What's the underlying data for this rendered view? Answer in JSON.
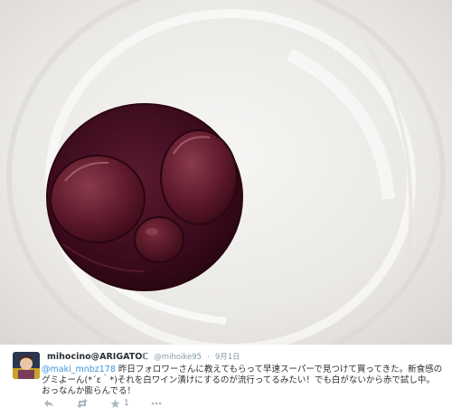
{
  "tweet": {
    "display_name": "mihocino@ARIGATOℂ",
    "handle": "@mihoike95",
    "separator": "·",
    "time": "9月1日",
    "mention": "@maki_mnbz178",
    "text": " 昨日フォロワーさんに教えてもらって早速スーパーで見つけて買ってきた。新食感のグミよーん(*´ε｀*)それを白ワイン漬けにするのが流行ってるみたい！でも白がないから赤で試し中。おっなんか膨らんでる！",
    "favorite_count": "1"
  },
  "icons": {
    "reply": "reply-icon",
    "retweet": "retweet-icon",
    "favorite": "star-icon"
  },
  "colors": {
    "mention": "#3b94d9",
    "action_gray": "#aab8c2",
    "wine": "#3a0a1a"
  }
}
